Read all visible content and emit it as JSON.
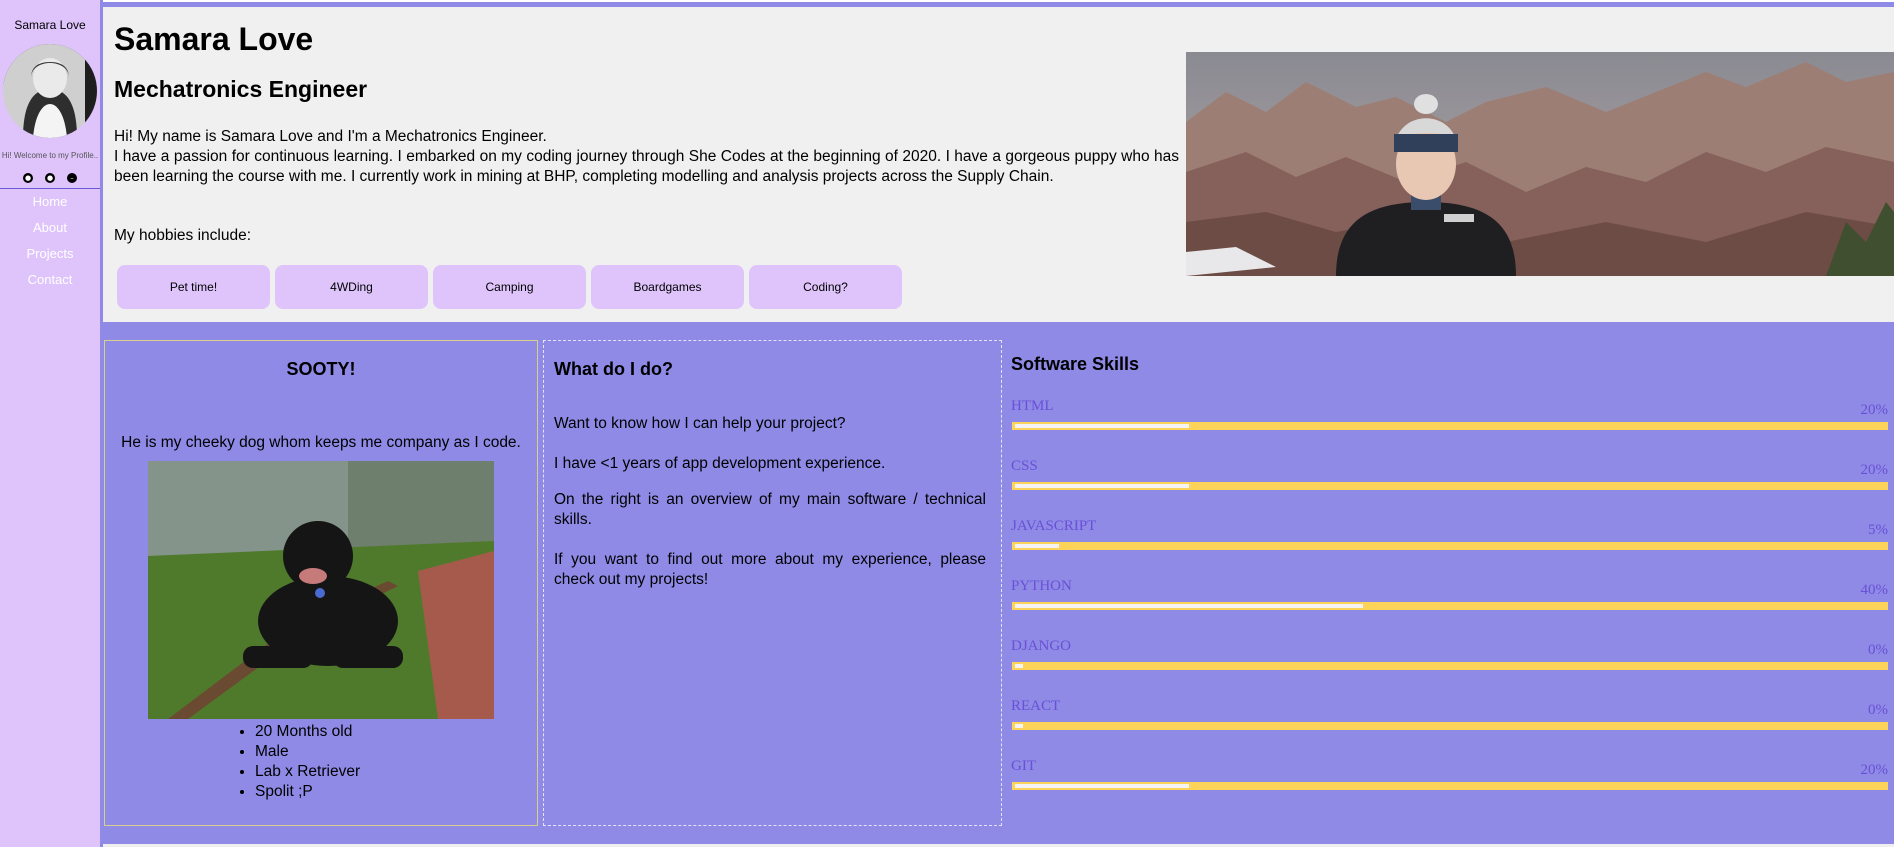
{
  "sidebar": {
    "name": "Samara Love",
    "welcome": "Hi! Welcome to my Profile..",
    "social_icons": [
      "github-icon",
      "github-icon",
      "linkedin-icon"
    ],
    "nav": [
      {
        "label": "Home"
      },
      {
        "label": "About"
      },
      {
        "label": "Projects"
      },
      {
        "label": "Contact"
      }
    ]
  },
  "header": {
    "name": "Samara Love",
    "title": "Mechatronics Engineer",
    "intro_line1": "Hi! My name is Samara Love and I'm a Mechatronics Engineer.",
    "intro_line2": "I have a passion for continuous learning. I embarked on my coding journey through She Codes at the beginning of 2020. I have a gorgeous puppy who has been learning the course with me. I currently work in mining at BHP, completing modelling and analysis projects across the Supply Chain.",
    "hobbies_label": "My hobbies include:",
    "hobbies": [
      "Pet time!",
      "4WDing",
      "Camping",
      "Boardgames",
      "Coding?"
    ]
  },
  "sooty": {
    "title": "SOOTY!",
    "description": "He is my cheeky dog whom keeps me company as I code.",
    "facts": [
      "20 Months old",
      "Male",
      "Lab x Retriever",
      "Spolit ;P"
    ]
  },
  "whatdo": {
    "title": "What do I do?",
    "p1": "Want to know how I can help your project?",
    "p2": "I have <1 years of app development experience.",
    "p3": "On the right is an overview of my main software / technical skills.",
    "p4": "If you want to find out more about my experience, please check out my projects!"
  },
  "skills": {
    "title": "Software Skills",
    "items": [
      {
        "name": "HTML",
        "percent_label": "20%",
        "level": 0.2
      },
      {
        "name": "CSS",
        "percent_label": "20%",
        "level": 0.2
      },
      {
        "name": "JAVASCRIPT",
        "percent_label": "5%",
        "level": 0.05
      },
      {
        "name": "PYTHON",
        "percent_label": "40%",
        "level": 0.4
      },
      {
        "name": "DJANGO",
        "percent_label": "0%",
        "level": 0.0
      },
      {
        "name": "REACT",
        "percent_label": "0%",
        "level": 0.0
      },
      {
        "name": "GIT",
        "percent_label": "20%",
        "level": 0.2
      }
    ]
  },
  "colors": {
    "sidebar_bg": "#dfc4fc",
    "accent_purple": "#8e8ae6",
    "skill_text": "#6a50d6",
    "skill_bar": "#fdd35a"
  }
}
